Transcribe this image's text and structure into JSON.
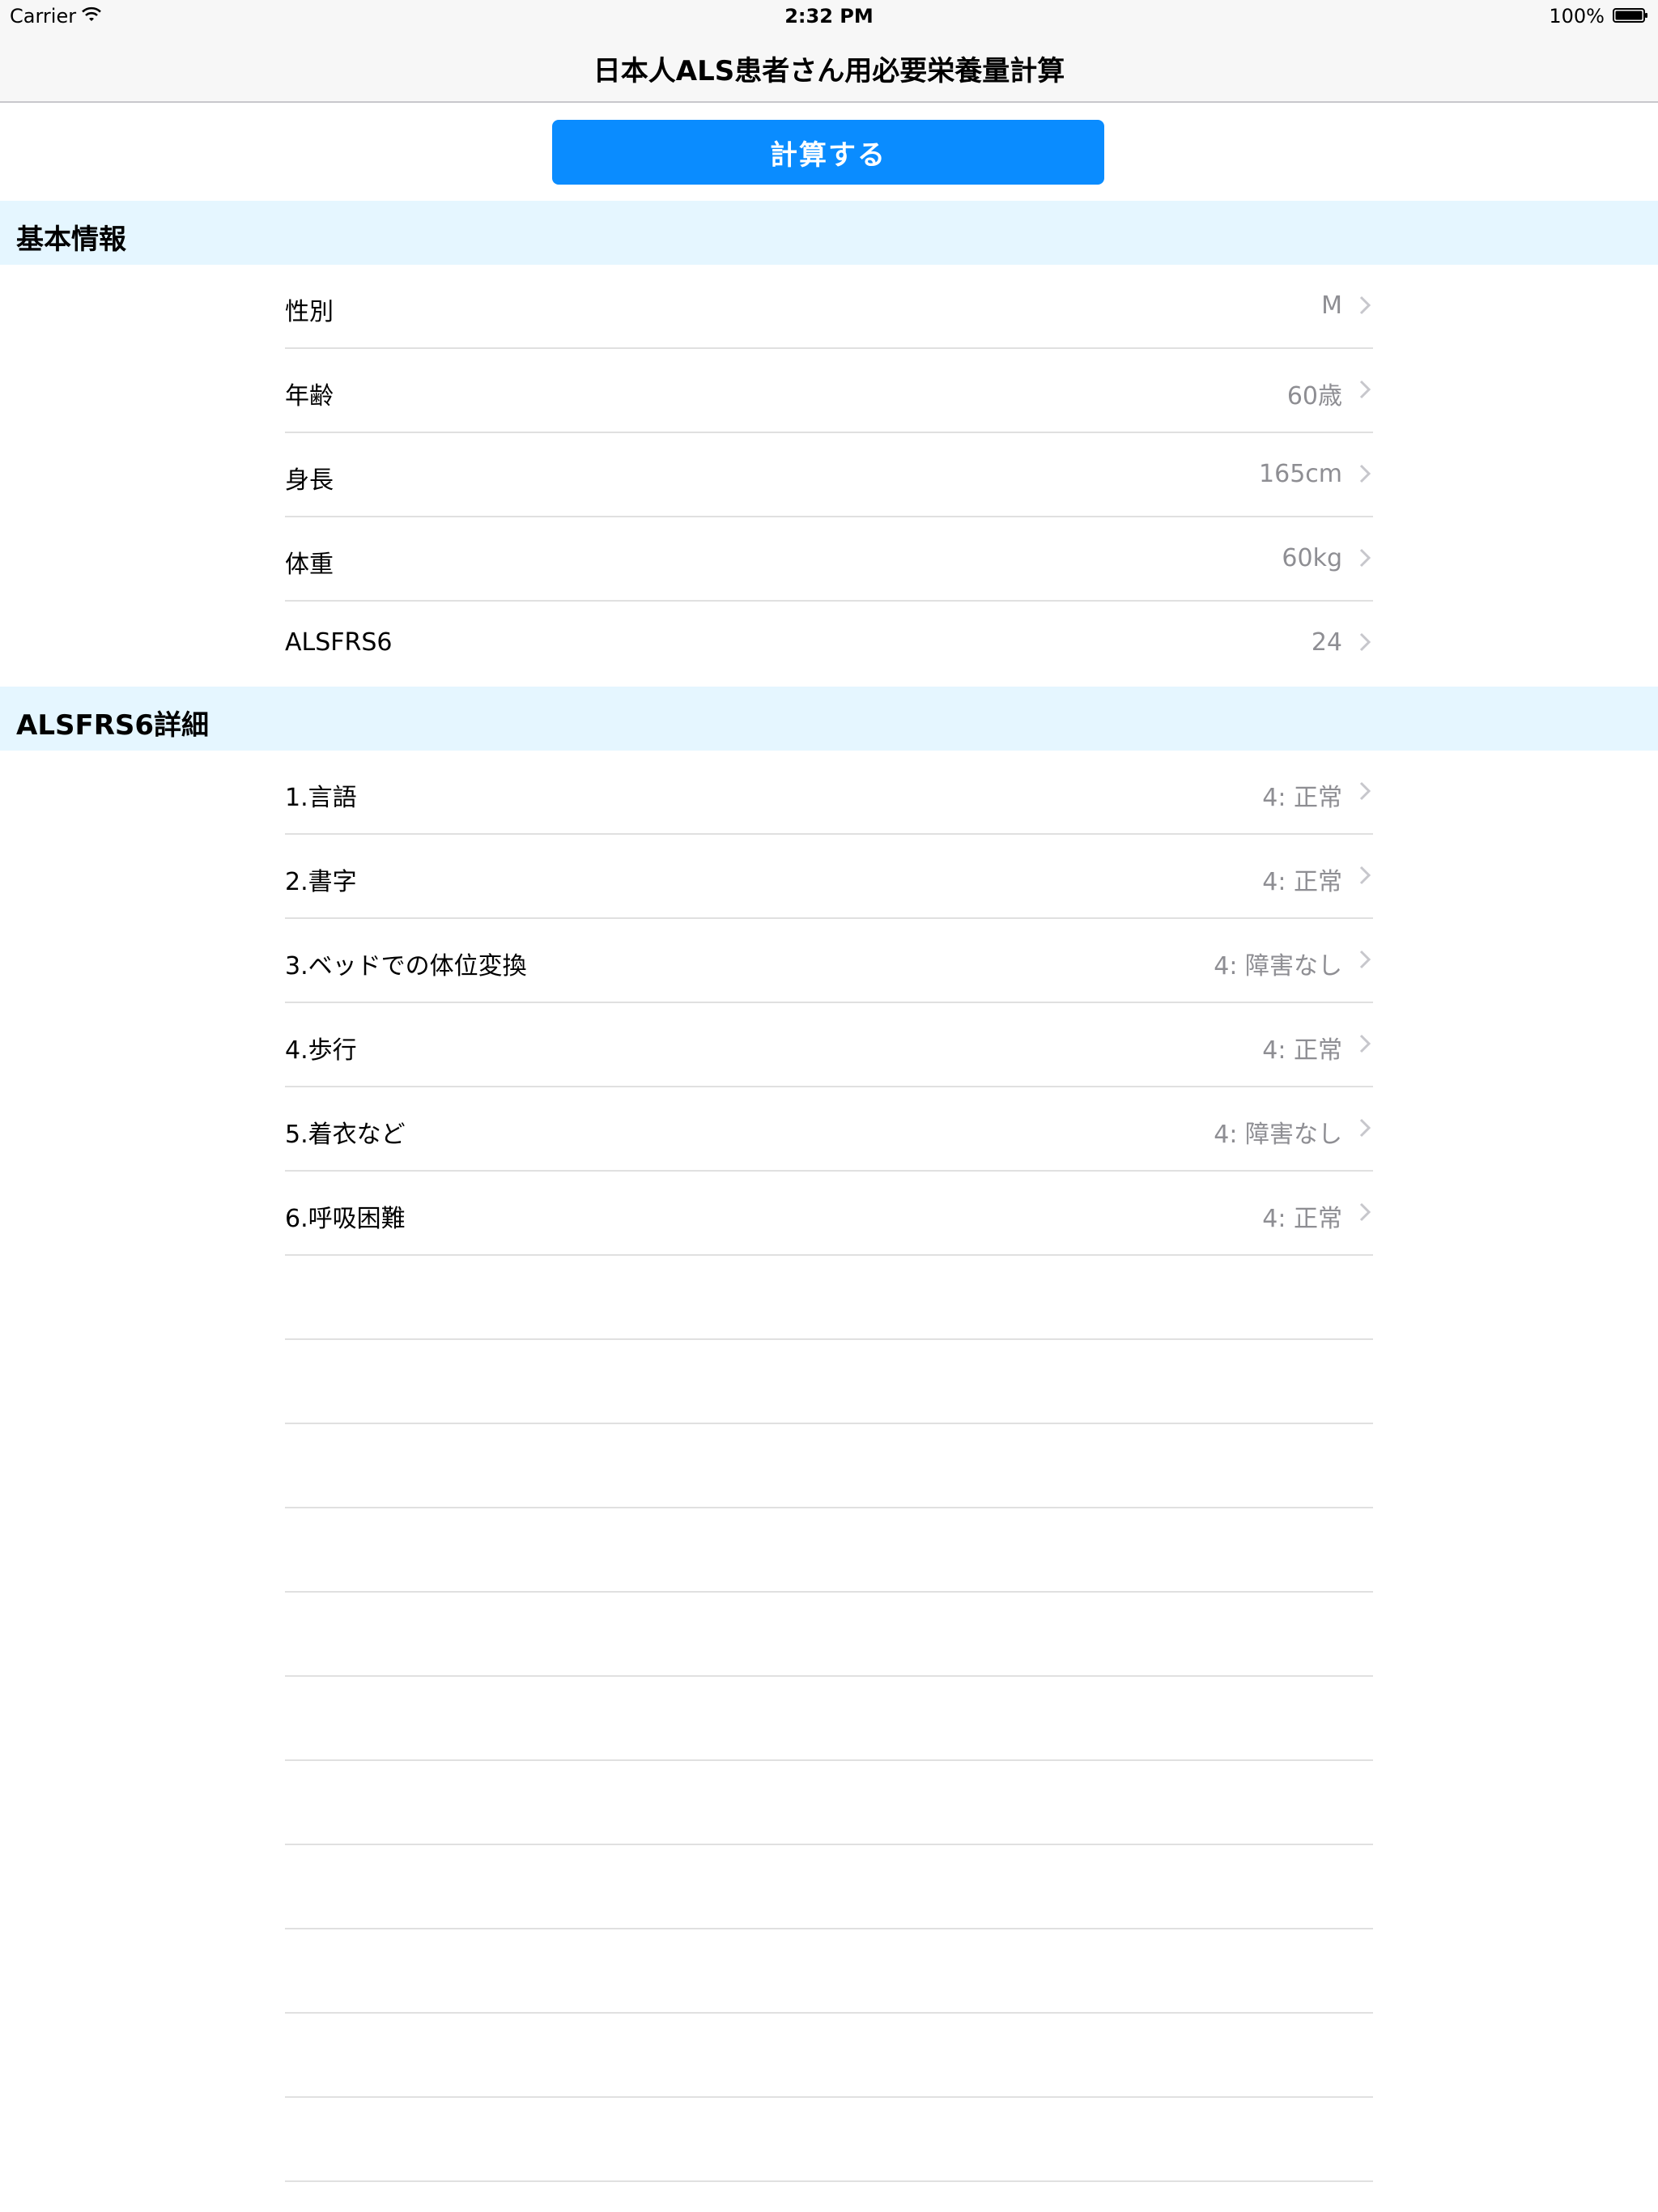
{
  "status_bar": {
    "carrier": "Carrier",
    "time": "2:32 PM",
    "battery": "100%"
  },
  "nav": {
    "title": "日本人ALS患者さん用必要栄養量計算"
  },
  "calculate_button": "計算する",
  "colors": {
    "accent": "#0a8cff",
    "section_bg": "#e5f6ff",
    "value_gray": "#8e8e93",
    "separator": "#e0e0e0"
  },
  "basic": {
    "header": "基本情報",
    "rows": [
      {
        "label": "性別",
        "value": "M"
      },
      {
        "label": "年齢",
        "value": "60歳"
      },
      {
        "label": "身長",
        "value": "165cm"
      },
      {
        "label": "体重",
        "value": "60kg"
      },
      {
        "label": "ALSFRS6",
        "value": "24"
      }
    ]
  },
  "detail": {
    "header": "ALSFRS6詳細",
    "rows": [
      {
        "label": "1.言語",
        "value": "4: 正常"
      },
      {
        "label": "2.書字",
        "value": "4: 正常"
      },
      {
        "label": "3.ベッドでの体位変換",
        "value": "4: 障害なし"
      },
      {
        "label": "4.歩行",
        "value": "4: 正常"
      },
      {
        "label": "5.着衣など",
        "value": "4: 障害なし"
      },
      {
        "label": "6.呼吸困難",
        "value": "4: 正常"
      }
    ]
  }
}
